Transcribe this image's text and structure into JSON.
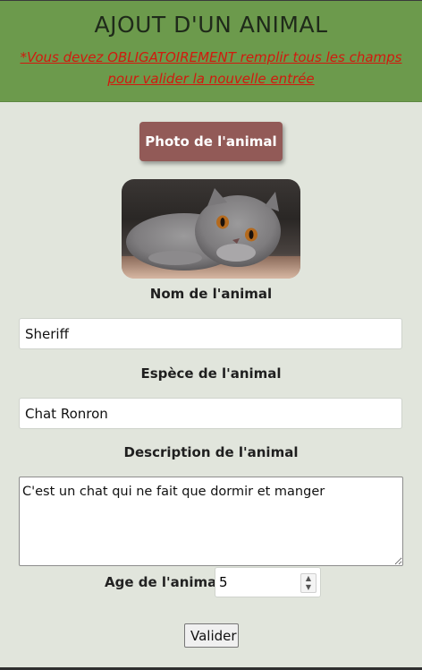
{
  "header": {
    "title": "AJOUT D'UN ANIMAL",
    "warning": "*Vous devez OBLIGATOIREMENT remplir tous les champs pour valider la nouvelle entrée"
  },
  "photo": {
    "button_label": "Photo de l'animal"
  },
  "form": {
    "name_label": "Nom de l'animal",
    "name_value": "Sheriff",
    "species_label": "Espèce de l'animal",
    "species_value": "Chat Ronron",
    "description_label": "Description de l'animal",
    "description_value": "C'est un chat qui ne fait que dormir et manger",
    "age_label": "Age de l'animal",
    "age_value": "5",
    "submit_label": "Valider"
  },
  "colors": {
    "header_bg": "#6c9a4c",
    "warning_text": "#d11a0e",
    "photo_button_bg": "#925a57",
    "page_bg": "#e1e5dc"
  }
}
